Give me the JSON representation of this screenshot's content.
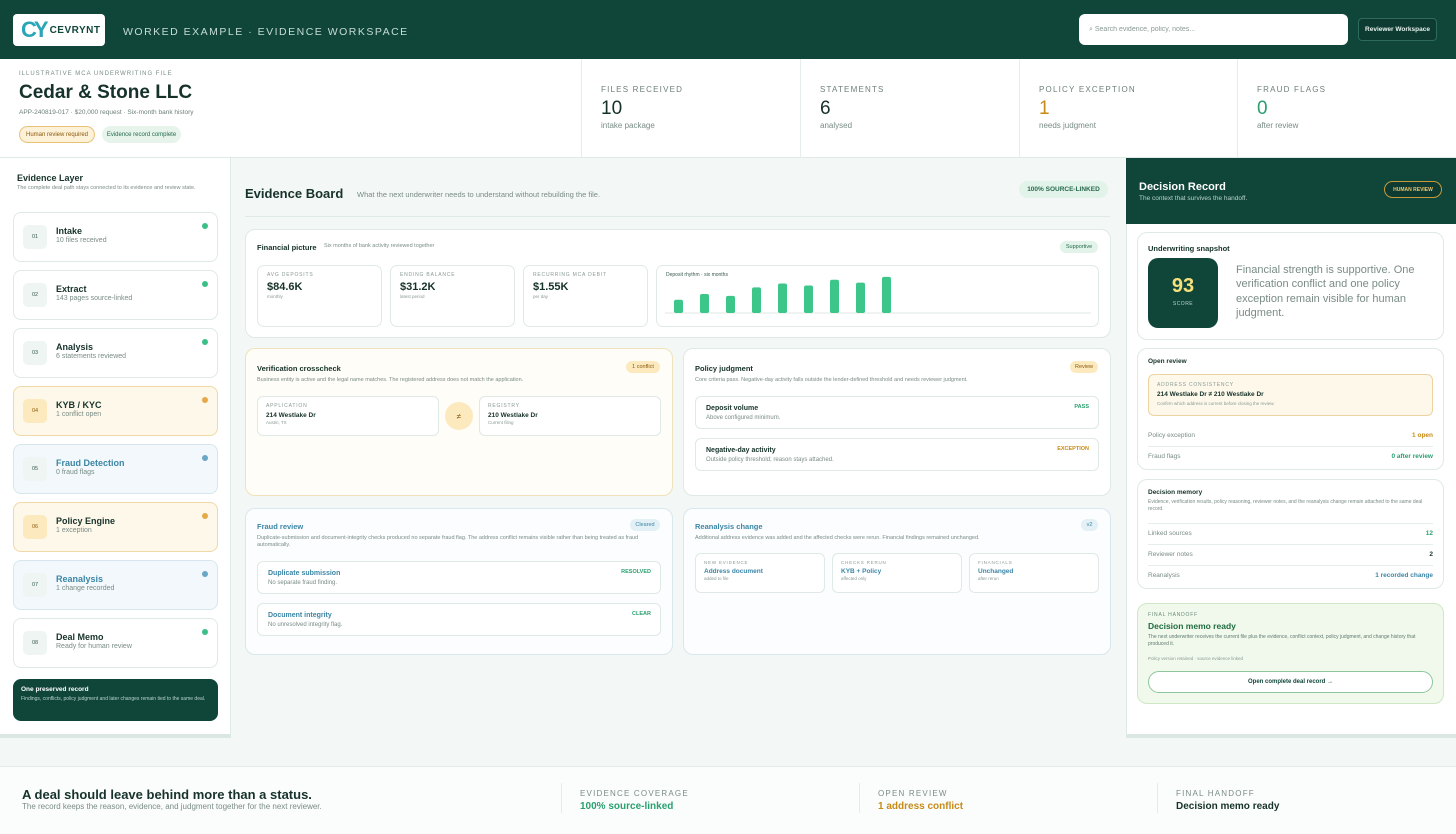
{
  "header": {
    "logo_mark": "CY",
    "logo_word": "CEVRYNT",
    "title": "WORKED EXAMPLE · EVIDENCE WORKSPACE",
    "search_placeholder": "⌕ Search evidence, policy, notes...",
    "reviewer_button": "Reviewer Workspace"
  },
  "summary": {
    "kicker": "ILLUSTRATIVE MCA UNDERWRITING FILE",
    "company": "Cedar & Stone LLC",
    "meta": "APP-240819-017 · $20,000 request · Six-month bank history",
    "badges": [
      "Human review required",
      "Evidence record complete"
    ],
    "metrics": [
      {
        "label": "FILES RECEIVED",
        "value": "10",
        "sub": "intake package",
        "color": "#16322a"
      },
      {
        "label": "STATEMENTS",
        "value": "6",
        "sub": "analysed",
        "color": "#16322a"
      },
      {
        "label": "POLICY EXCEPTION",
        "value": "1",
        "sub": "needs judgment",
        "color": "#c78a16"
      },
      {
        "label": "FRAUD FLAGS",
        "value": "0",
        "sub": "after review",
        "color": "#2aa06f"
      }
    ]
  },
  "rail": {
    "title": "Evidence Layer",
    "subtitle": "The complete deal path stays connected to its evidence and review state.",
    "stages": [
      {
        "num": "01",
        "name": "Intake",
        "desc": "10 files received",
        "state": "ok"
      },
      {
        "num": "02",
        "name": "Extract",
        "desc": "143 pages source-linked",
        "state": "ok"
      },
      {
        "num": "03",
        "name": "Analysis",
        "desc": "6 statements reviewed",
        "state": "ok"
      },
      {
        "num": "04",
        "name": "KYB / KYC",
        "desc": "1 conflict open",
        "state": "warn"
      },
      {
        "num": "05",
        "name": "Fraud Detection",
        "desc": "0 fraud flags",
        "state": "info"
      },
      {
        "num": "06",
        "name": "Policy Engine",
        "desc": "1 exception",
        "state": "warn"
      },
      {
        "num": "07",
        "name": "Reanalysis",
        "desc": "1 change recorded",
        "state": "info"
      },
      {
        "num": "08",
        "name": "Deal Memo",
        "desc": "Ready for human review",
        "state": "ok"
      }
    ],
    "preserved_title": "One preserved record",
    "preserved_desc": "Findings, conflicts, policy judgment and later changes remain tied to the same deal."
  },
  "board": {
    "title": "Evidence Board",
    "subtitle": "What the next underwriter needs to understand without rebuilding the file.",
    "badge": "100% SOURCE-LINKED",
    "financial": {
      "title": "Financial picture",
      "sub": "Six months of bank activity reviewed together",
      "pill": "Supportive",
      "minis": [
        {
          "label": "AVG DEPOSITS",
          "value": "$84.6K",
          "sub": "monthly"
        },
        {
          "label": "ENDING BALANCE",
          "value": "$31.2K",
          "sub": "latest period"
        },
        {
          "label": "RECURRING MCA DEBIT",
          "value": "$1.55K",
          "sub": "per day"
        }
      ],
      "chart_title": "Deposit rhythm · six months"
    },
    "verification": {
      "title": "Verification crosscheck",
      "sub": "Business entity is active and the legal name matches. The registered address does not match the application.",
      "pill": "1 conflict",
      "neq": "≠",
      "app": {
        "label": "APPLICATION",
        "value": "214 Westlake Dr",
        "sub": "Austin, TX"
      },
      "reg": {
        "label": "REGISTRY",
        "value": "210 Westlake Dr",
        "sub": "Current filing"
      }
    },
    "policy": {
      "title": "Policy judgment",
      "sub": "Core criteria pass. Negative-day activity falls outside the lender-defined threshold and needs reviewer judgment.",
      "pill": "Review",
      "items": [
        {
          "name": "Deposit volume",
          "desc": "Above configured minimum.",
          "status": "PASS"
        },
        {
          "name": "Negative-day activity",
          "desc": "Outside policy threshold; reason stays attached.",
          "status": "EXCEPTION"
        }
      ]
    },
    "fraud": {
      "title": "Fraud review",
      "sub": "Duplicate-submission and document-integrity checks produced no separate fraud flag. The address conflict remains visible rather than being treated as fraud automatically.",
      "pill": "Cleared",
      "items": [
        {
          "name": "Duplicate submission",
          "desc": "No separate fraud finding.",
          "status": "RESOLVED"
        },
        {
          "name": "Document integrity",
          "desc": "No unresolved integrity flag.",
          "status": "CLEAR"
        }
      ]
    },
    "reanalysis": {
      "title": "Reanalysis change",
      "sub": "Additional address evidence was added and the affected checks were rerun. Financial findings remained unchanged.",
      "pill": "v2",
      "boxes": [
        {
          "label": "NEW EVIDENCE",
          "value": "Address document",
          "sub": "added to file"
        },
        {
          "label": "CHECKS RERUN",
          "value": "KYB + Policy",
          "sub": "affected only"
        },
        {
          "label": "FINANCIALS",
          "value": "Unchanged",
          "sub": "after rerun"
        }
      ]
    }
  },
  "chart_data": {
    "type": "bar",
    "title": "Deposit rhythm · six months",
    "categories": [
      "1",
      "2",
      "3",
      "4",
      "5",
      "6",
      "7",
      "8",
      "9"
    ],
    "values": [
      14,
      20,
      18,
      27,
      31,
      29,
      35,
      32,
      38
    ],
    "ylim": [
      0,
      40
    ],
    "xlabel": "",
    "ylabel": "",
    "grid": false,
    "bar_color": "#3cc68a"
  },
  "decision": {
    "title": "Decision Record",
    "sub": "The context that survives the handoff.",
    "badge": "HUMAN REVIEW",
    "snapshot_title": "Underwriting snapshot",
    "score": "93",
    "score_label": "SCORE",
    "snapshot_text": "Financial strength is supportive. One verification conflict and one policy exception remain visible for human judgment.",
    "open_title": "Open review",
    "addr_kicker": "ADDRESS CONSISTENCY",
    "addr_value": "214 Westlake Dr ≠ 210 Westlake Dr",
    "addr_sub": "Confirm which address is current before closing the review.",
    "open_rows": [
      {
        "k": "Policy exception",
        "v": "1 open",
        "color": "#c78a16"
      },
      {
        "k": "Fraud flags",
        "v": "0 after review",
        "color": "#2aa06f"
      }
    ],
    "memory_title": "Decision memory",
    "memory_sub": "Evidence, verification results, policy reasoning, reviewer notes, and the reanalysis change remain attached to the same deal record.",
    "memory_rows": [
      {
        "k": "Linked sources",
        "v": "12",
        "color": "#2aa06f"
      },
      {
        "k": "Reviewer notes",
        "v": "2",
        "color": "#16322a"
      },
      {
        "k": "Reanalysis",
        "v": "1 recorded change",
        "color": "#3b86a6"
      }
    ],
    "handoff_kicker": "FINAL HANDOFF",
    "handoff_title": "Decision memo ready",
    "handoff_sub": "The next underwriter receives the current file plus the evidence, conflict context, policy judgment, and change history that produced it.",
    "handoff_meta": "Policy version retained · source evidence linked",
    "handoff_button": "Open complete deal record →"
  },
  "footer": {
    "title": "A deal should leave behind more than a status.",
    "sub": "The record keeps the reason, evidence, and judgment together for the next reviewer.",
    "metrics": [
      {
        "label": "EVIDENCE COVERAGE",
        "value": "100% source-linked",
        "color": "#2aa06f"
      },
      {
        "label": "OPEN REVIEW",
        "value": "1 address conflict",
        "color": "#c78a16"
      },
      {
        "label": "FINAL HANDOFF",
        "value": "Decision memo ready",
        "color": "#16322a"
      }
    ]
  }
}
